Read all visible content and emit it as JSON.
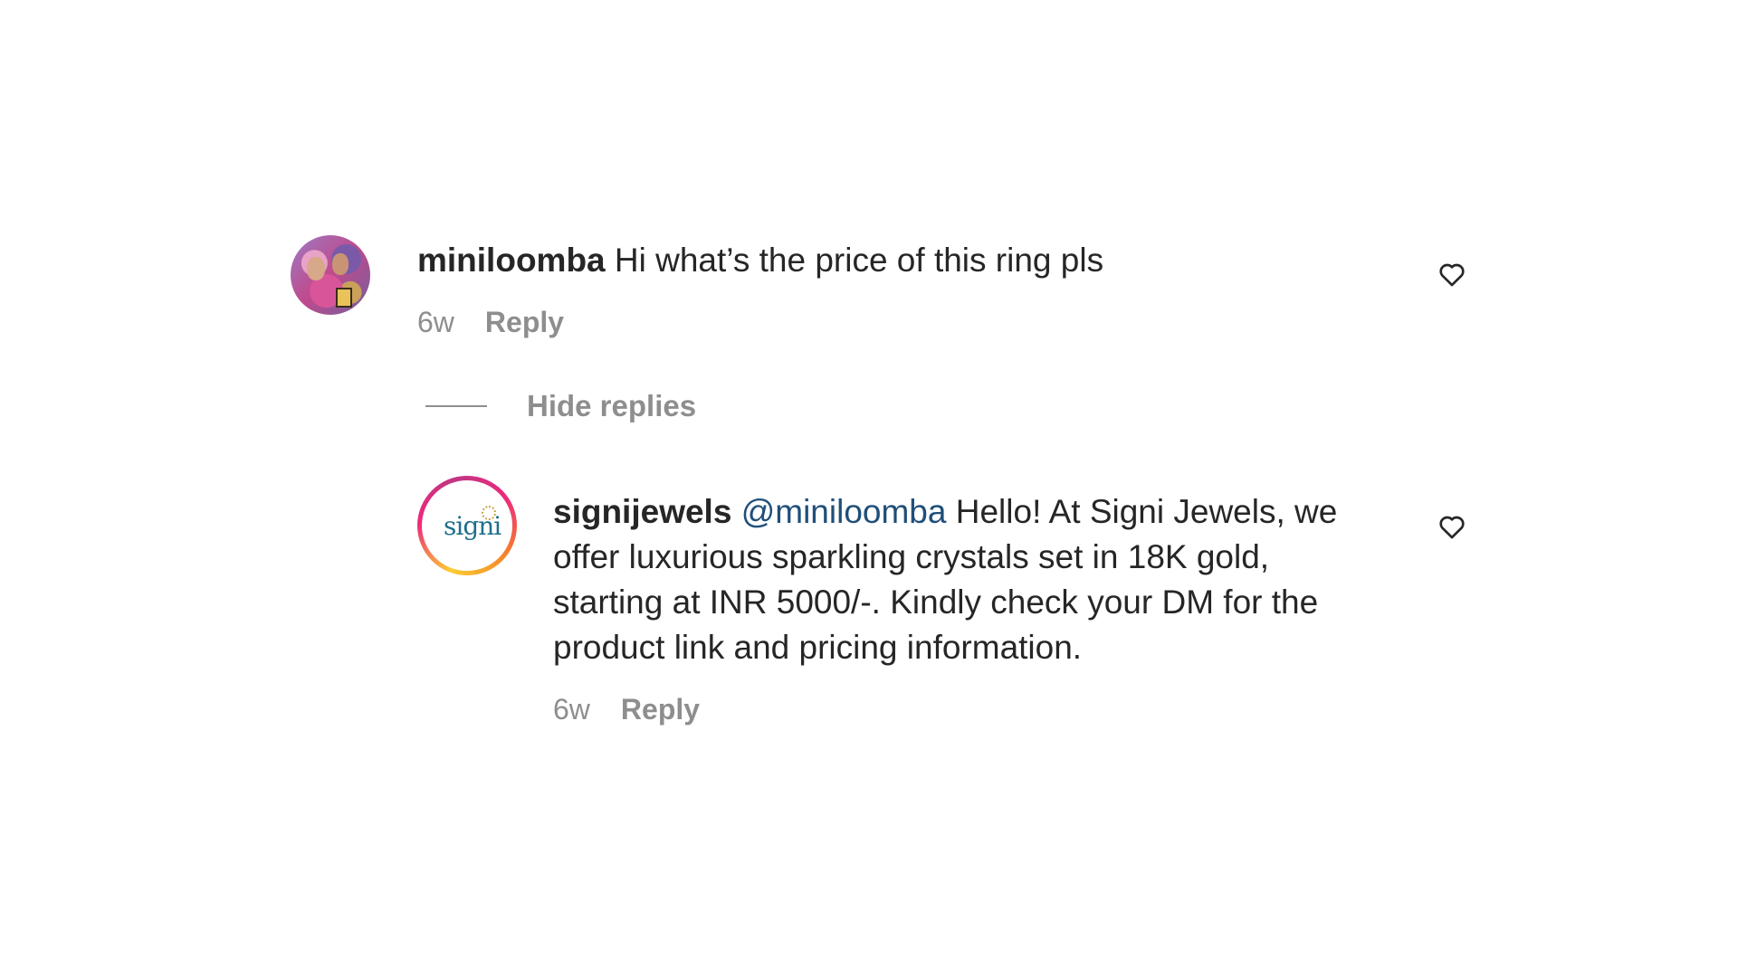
{
  "comment": {
    "username": "miniloomba",
    "text": "Hi what’s the price of this ring pls",
    "time": "6w",
    "reply_label": "Reply"
  },
  "replies_toggle": {
    "label": "Hide replies"
  },
  "reply": {
    "username": "signijewels",
    "mention": "@miniloomba",
    "text": "Hello! At Signi Jewels, we offer luxurious sparkling crystals set in 18K gold, starting at INR 5000/-. Kindly check your DM for the product link and pricing information.",
    "time": "6w",
    "reply_label": "Reply",
    "avatar_logo": "signi"
  },
  "icons": {
    "like": "heart-outline-icon"
  }
}
